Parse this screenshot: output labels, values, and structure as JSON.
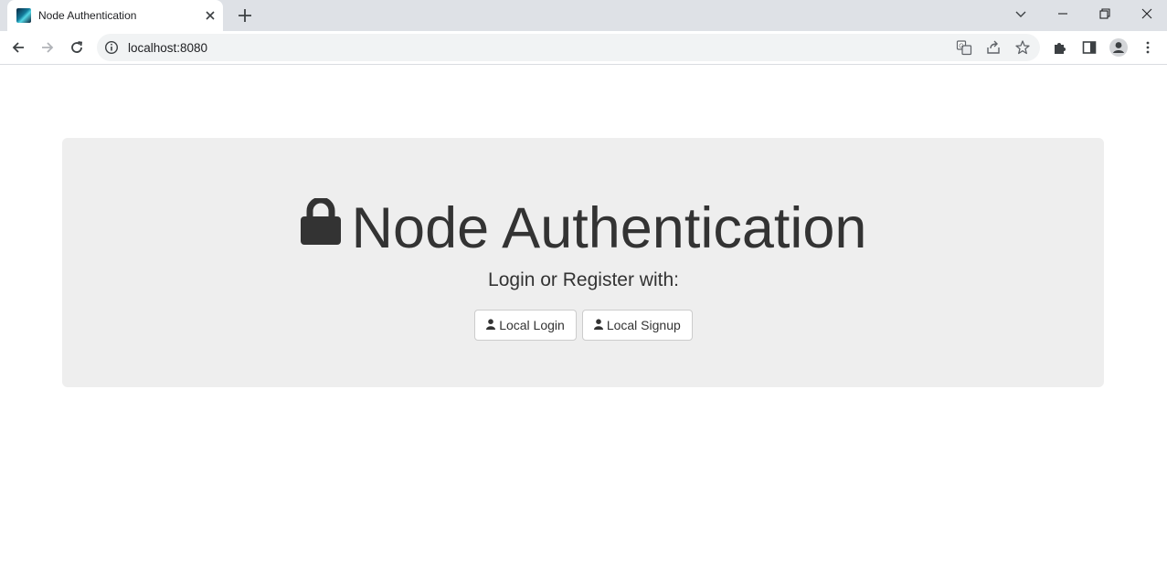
{
  "browser": {
    "tab": {
      "title": "Node Authentication",
      "favicon": "app-favicon",
      "close_icon": "close-icon"
    },
    "new_tab_icon": "plus-icon",
    "window_controls": [
      "tab-search-icon",
      "minimize-icon",
      "restore-icon",
      "close-icon"
    ],
    "toolbar": {
      "back_icon": "back-arrow-icon",
      "forward_icon": "forward-arrow-icon",
      "reload_icon": "reload-icon",
      "site_info_icon": "info-icon",
      "url": "localhost:8080",
      "omnibox_icons": [
        "translate-icon",
        "share-icon",
        "bookmark-star-icon"
      ],
      "right_icons": [
        "extensions-puzzle-icon",
        "side-panel-icon",
        "profile-avatar-icon",
        "more-menu-icon"
      ]
    }
  },
  "page": {
    "title": "Node Authentication",
    "title_icon": "lock-icon",
    "subtitle": "Login or Register with:",
    "buttons": [
      {
        "label": "Local Login",
        "icon": "user-icon"
      },
      {
        "label": "Local Signup",
        "icon": "user-icon"
      }
    ],
    "colors": {
      "jumbotron_bg": "#eeeeee",
      "text": "#333333",
      "tabstrip_bg": "#dee1e6"
    }
  }
}
